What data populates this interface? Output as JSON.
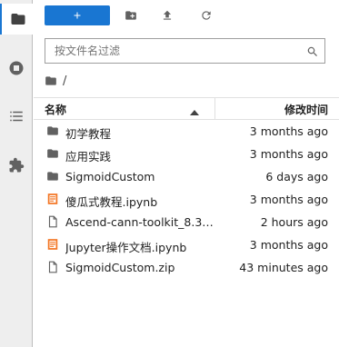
{
  "toolbar": {
    "new_icon": "plus-icon",
    "new_folder_icon": "new-folder-icon",
    "upload_icon": "upload-icon",
    "refresh_icon": "refresh-icon"
  },
  "search": {
    "placeholder": "按文件名过滤",
    "value": ""
  },
  "breadcrumb": {
    "path": "/"
  },
  "table": {
    "col_name": "名称",
    "col_modified": "修改时间",
    "sort": "ascending"
  },
  "files": [
    {
      "type": "folder",
      "name": "初学教程",
      "modified": "3 months ago"
    },
    {
      "type": "folder",
      "name": "应用实践",
      "modified": "3 months ago"
    },
    {
      "type": "folder",
      "name": "SigmoidCustom",
      "modified": "6 days ago"
    },
    {
      "type": "notebook",
      "name": "傻瓜式教程.ipynb",
      "modified": "3 months ago"
    },
    {
      "type": "file",
      "name": "Ascend-cann-toolkit_8.3.R...",
      "modified": "2 hours ago"
    },
    {
      "type": "notebook",
      "name": "Jupyter操作文档.ipynb",
      "modified": "3 months ago"
    },
    {
      "type": "file",
      "name": "SigmoidCustom.zip",
      "modified": "43 minutes ago"
    }
  ],
  "sidebar": {
    "items": [
      {
        "icon": "folder-icon",
        "active": true
      },
      {
        "icon": "stop-circle-icon",
        "active": false
      },
      {
        "icon": "list-icon",
        "active": false
      },
      {
        "icon": "puzzle-icon",
        "active": false
      }
    ]
  },
  "colors": {
    "accent": "#1976d2",
    "notebook": "#f37726"
  }
}
